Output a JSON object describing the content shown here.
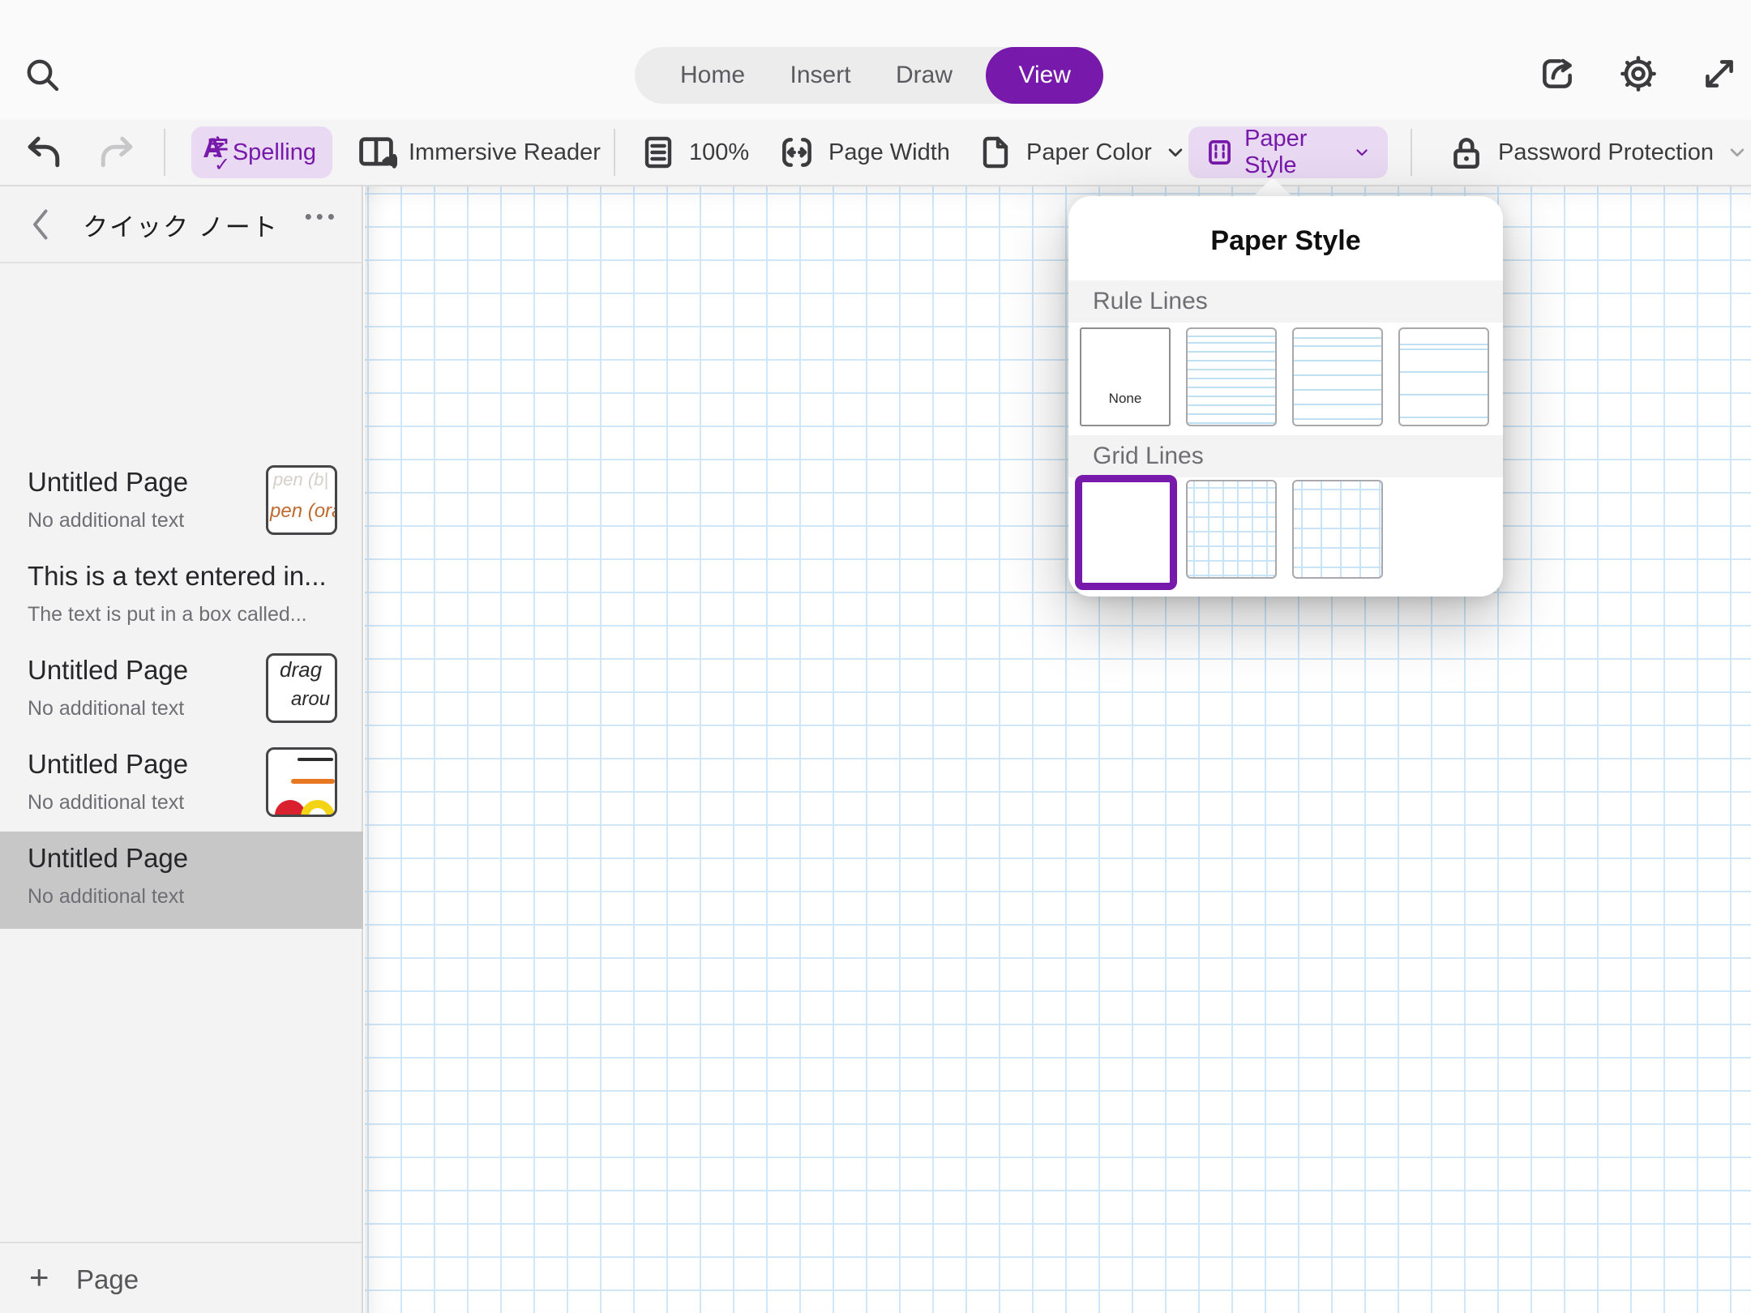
{
  "topbar": {
    "tabs": [
      {
        "label": "Home",
        "active": false
      },
      {
        "label": "Insert",
        "active": false
      },
      {
        "label": "Draw",
        "active": false
      },
      {
        "label": "View",
        "active": true
      }
    ],
    "icons": [
      "search-icon",
      "share-icon",
      "settings-gear-icon",
      "expand-icon"
    ]
  },
  "ribbon": {
    "undo_enabled": true,
    "redo_enabled": false,
    "spelling": {
      "label": "Spelling",
      "glyph_zi": "字",
      "glyph_a": "A",
      "glyph_check": "✓",
      "highlighted": true
    },
    "immersive_reader_label": "Immersive Reader",
    "zoom_label": "100%",
    "page_width_label": "Page Width",
    "paper_color_label": "Paper Color",
    "paper_style": {
      "label": "Paper Style",
      "highlighted": true
    },
    "password_protection_label": "Password Protection"
  },
  "sidebar": {
    "title": "クイック ノート",
    "more_label": "•••",
    "pages": [
      {
        "title": "Untitled Page",
        "subtitle": "No additional text",
        "thumbnail": {
          "kind": "pen-handwriting",
          "line1": "pen (b|",
          "line2": "pen (ora"
        },
        "selected": false
      },
      {
        "title": "This is a text entered in...",
        "subtitle": "The text is put in a box called...",
        "thumbnail": null,
        "selected": false
      },
      {
        "title": "Untitled Page",
        "subtitle": "No additional text",
        "thumbnail": {
          "kind": "drag-handwriting",
          "line1": "drag",
          "line2": "arou"
        },
        "selected": false
      },
      {
        "title": "Untitled Page",
        "subtitle": "No additional text",
        "thumbnail": {
          "kind": "colored-strokes"
        },
        "selected": false
      },
      {
        "title": "Untitled Page",
        "subtitle": "No additional text",
        "thumbnail": null,
        "selected": true
      }
    ],
    "add_page": {
      "plus": "+",
      "label": "Page"
    }
  },
  "popup": {
    "title": "Paper Style",
    "sections": [
      {
        "label": "Rule Lines",
        "options": [
          "none",
          "narrow",
          "college",
          "wide"
        ],
        "none_label": "None",
        "selected": null
      },
      {
        "label": "Grid Lines",
        "options": [
          "small",
          "medium",
          "large"
        ],
        "selected": "small"
      }
    ]
  },
  "colors": {
    "accent": "#7719aa",
    "accent_soft": "#e9d9f3",
    "canvas_grid_line": "#cfe7f9",
    "selected_row": "#c8c7c8",
    "ink_orange": "#e87722",
    "ink_red": "#d9202e",
    "ink_yellow": "#f3d414",
    "ink_black": "#2b2b2b"
  }
}
